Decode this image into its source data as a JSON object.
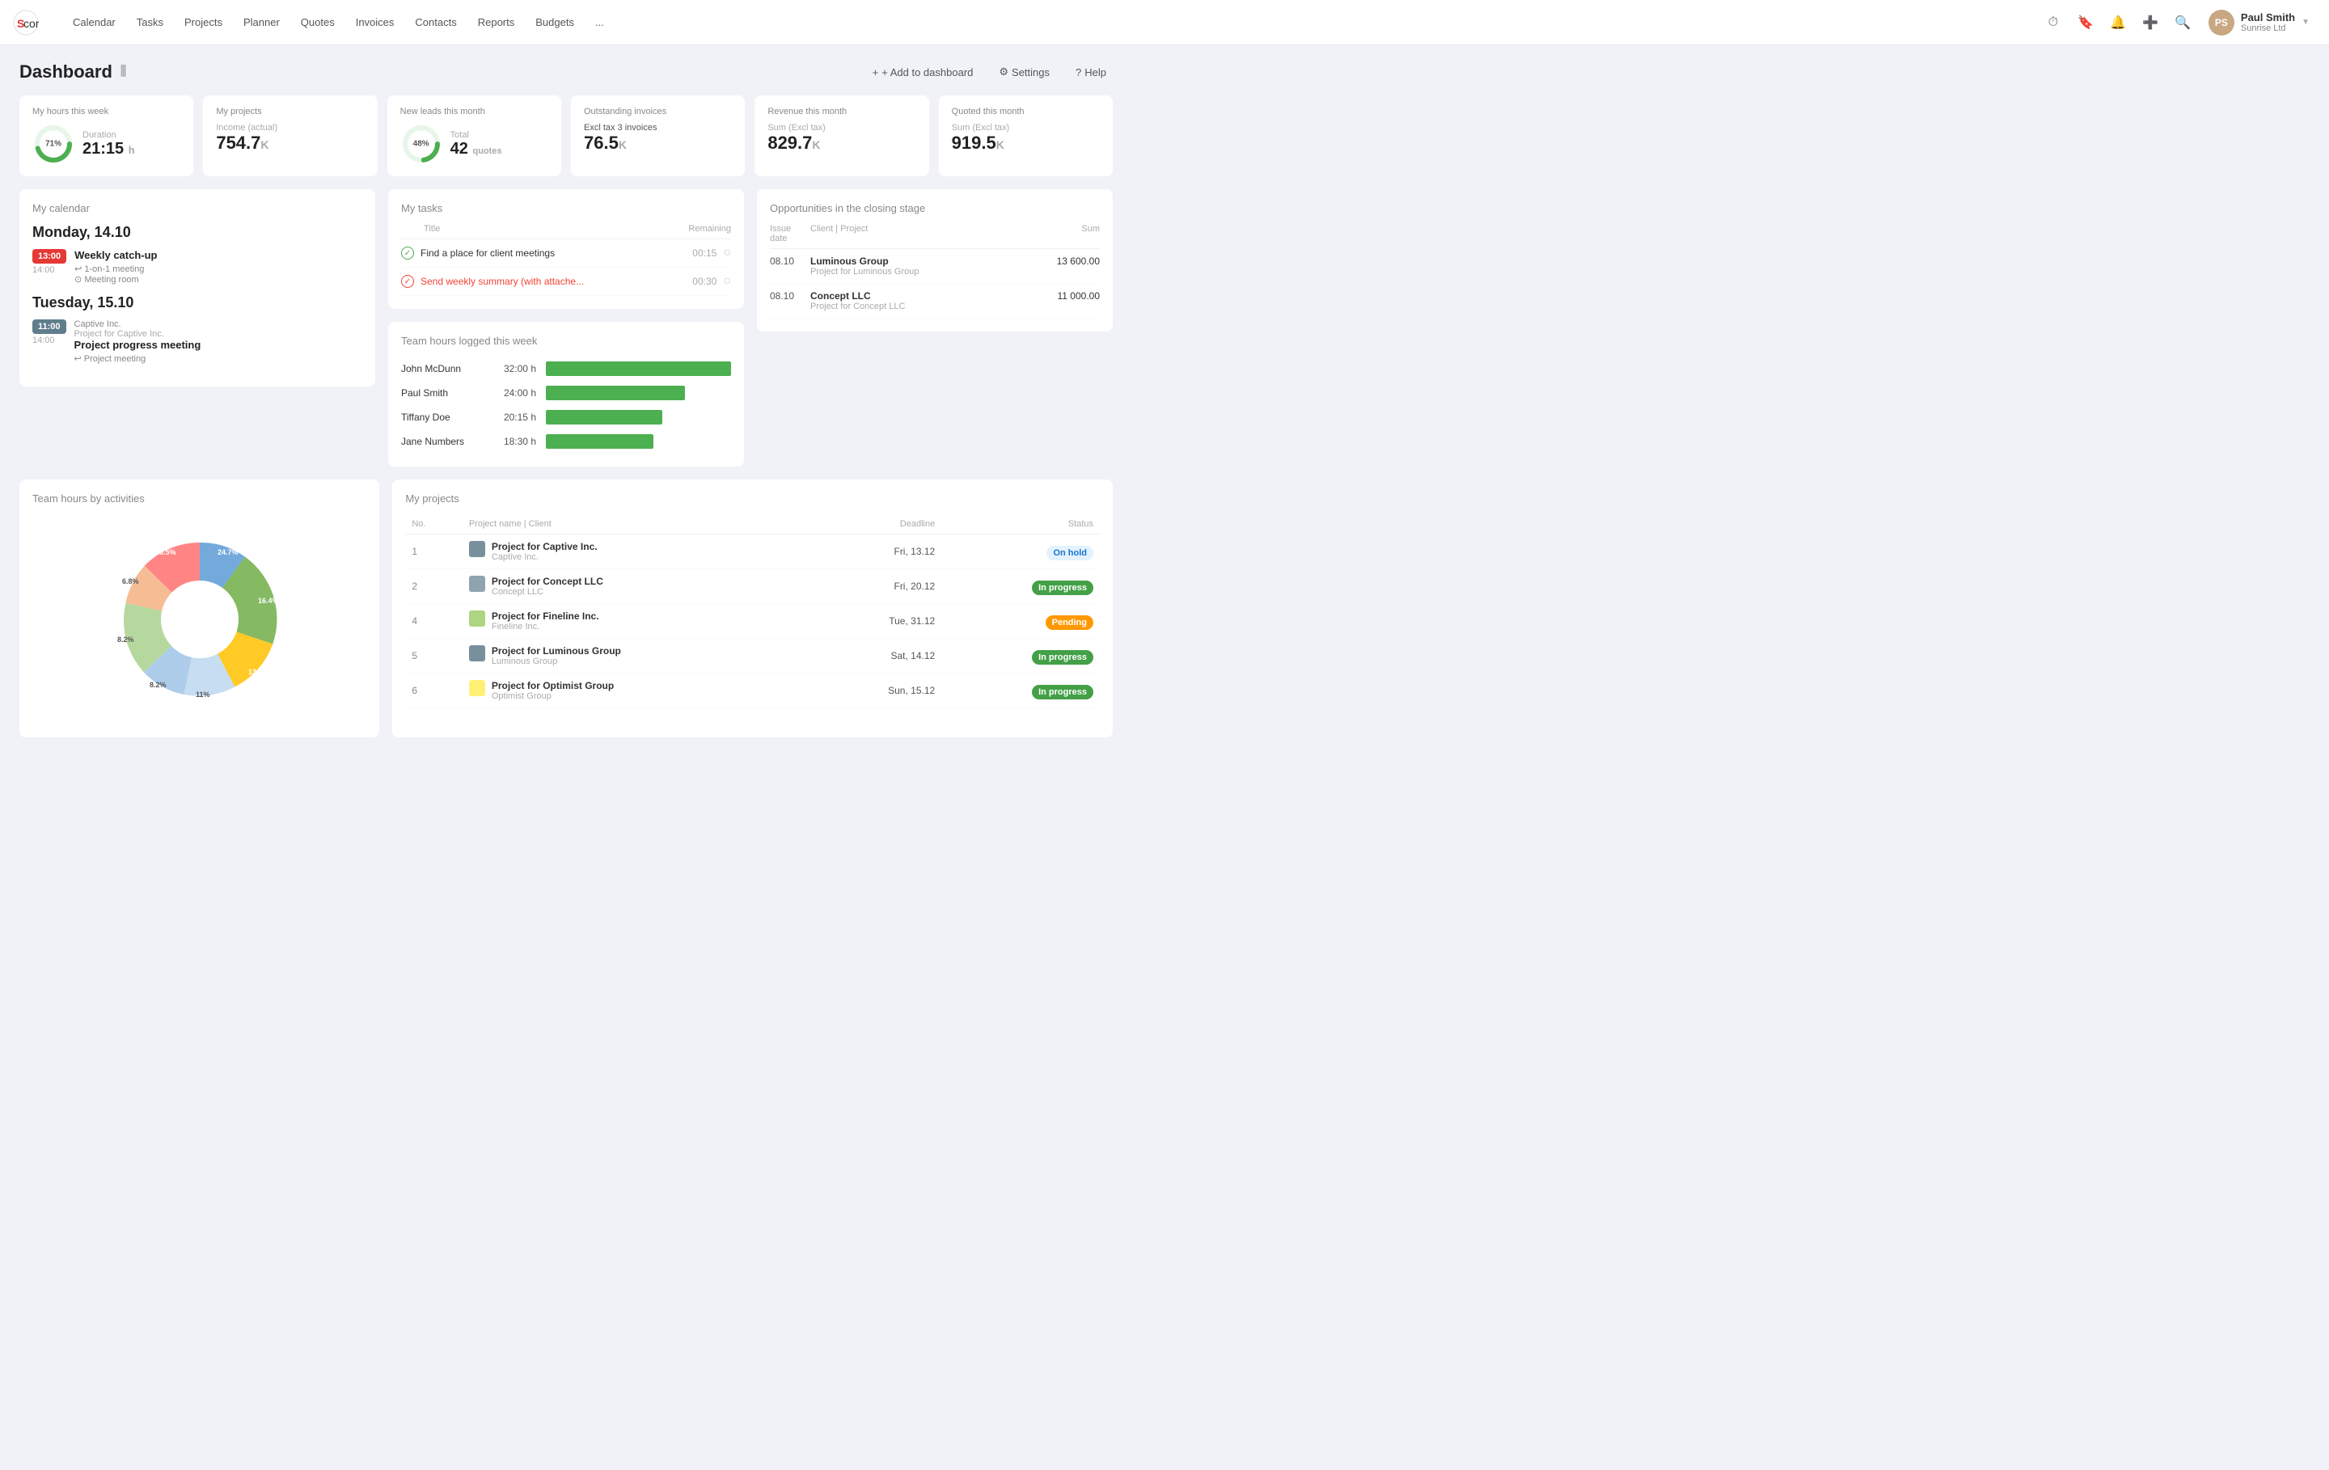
{
  "nav": {
    "logo_text": "Scoro",
    "links": [
      "Calendar",
      "Tasks",
      "Projects",
      "Planner",
      "Quotes",
      "Invoices",
      "Contacts",
      "Reports",
      "Budgets",
      "..."
    ],
    "user": {
      "name": "Paul Smith",
      "company": "Sunrise Ltd"
    }
  },
  "dashboard": {
    "title": "Dashboard",
    "actions": {
      "add": "+ Add to dashboard",
      "settings": "Settings",
      "help": "Help"
    }
  },
  "stat_cards": [
    {
      "label": "My hours this week",
      "has_donut": true,
      "donut_pct": 71,
      "donut_color": "#4caf50",
      "sub_label": "Duration",
      "value": "21:15",
      "unit": "h"
    },
    {
      "label": "My projects",
      "sub_label": "Income (actual)",
      "value": "754.7",
      "unit": "K"
    },
    {
      "label": "New leads this month",
      "has_donut": true,
      "donut_pct": 48,
      "donut_color": "#4caf50",
      "sub_label": "Total",
      "value": "42",
      "unit": "quotes"
    },
    {
      "label": "Outstanding invoices",
      "sub_label": "Excl tax 3 invoices",
      "value": "76.5",
      "unit": "K"
    },
    {
      "label": "Revenue this month",
      "sub_label": "Sum (Excl tax)",
      "value": "829.7",
      "unit": "K"
    },
    {
      "label": "Quoted this month",
      "sub_label": "Sum (Excl tax)",
      "value": "919.5",
      "unit": "K"
    }
  ],
  "calendar": {
    "title": "My calendar",
    "days": [
      {
        "date": "Monday, 14.10",
        "events": [
          {
            "start": "13:00",
            "end": "14:00",
            "title": "Weekly catch-up",
            "type": "1-on-1 meeting",
            "location": "Meeting room",
            "color": "#e53935"
          }
        ]
      },
      {
        "date": "Tuesday, 15.10",
        "events": [
          {
            "start": "11:00",
            "end": "14:00",
            "title": "Project progress meeting",
            "type": "Project meeting",
            "company": "Captive Inc.",
            "project": "Project for Captive Inc.",
            "color": "#607d8b"
          }
        ]
      }
    ]
  },
  "tasks": {
    "title": "My tasks",
    "columns": [
      "Title",
      "Remaining"
    ],
    "rows": [
      {
        "title": "Find a place for client meetings",
        "remaining": "00:15",
        "status": "done"
      },
      {
        "title": "Send weekly summary (with attache...",
        "remaining": "00:30",
        "status": "overdue"
      }
    ]
  },
  "team_hours": {
    "title": "Team hours logged this week",
    "rows": [
      {
        "name": "John McDunn",
        "hours": "32:00 h",
        "bar_pct": 100
      },
      {
        "name": "Paul Smith",
        "hours": "24:00 h",
        "bar_pct": 75
      },
      {
        "name": "Tiffany Doe",
        "hours": "20:15 h",
        "bar_pct": 63
      },
      {
        "name": "Jane Numbers",
        "hours": "18:30 h",
        "bar_pct": 58
      }
    ]
  },
  "opportunities": {
    "title": "Opportunities in the closing stage",
    "columns": [
      "Issue date",
      "Client | Project",
      "Sum"
    ],
    "rows": [
      {
        "date": "08.10",
        "client": "Luminous Group",
        "project": "Project for Luminous Group",
        "sum": "13 600.00"
      },
      {
        "date": "08.10",
        "client": "Concept LLC",
        "project": "Project for Concept LLC",
        "sum": "11 000.00"
      }
    ]
  },
  "team_hours_chart": {
    "title": "Team hours by activities",
    "segments": [
      {
        "pct": 24.7,
        "color": "#5b9bd5",
        "label": "24.7%"
      },
      {
        "pct": 16.4,
        "color": "#70ad47",
        "label": "16.4%"
      },
      {
        "pct": 13.7,
        "color": "#ffc000",
        "label": "13.7%"
      },
      {
        "pct": 11.0,
        "color": "#bdd7ee",
        "label": "11%"
      },
      {
        "pct": 8.2,
        "color": "#9dc3e6",
        "label": "8.2%"
      },
      {
        "pct": 8.2,
        "color": "#a9d18e",
        "label": "8.2%"
      },
      {
        "pct": 6.8,
        "color": "#f4b183",
        "label": "6.8%"
      },
      {
        "pct": 5.5,
        "color": "#ff7070",
        "label": "5.5%"
      }
    ]
  },
  "my_projects": {
    "title": "My projects",
    "columns": [
      "No.",
      "Project name | Client",
      "Deadline",
      "Status"
    ],
    "rows": [
      {
        "num": "1",
        "name": "Project for Captive Inc.",
        "client": "Captive Inc.",
        "deadline": "Fri, 13.12",
        "status": "On hold",
        "status_class": "onhold",
        "icon_color": "#78909c"
      },
      {
        "num": "2",
        "name": "Project for Concept LLC",
        "client": "Concept LLC",
        "deadline": "Fri, 20.12",
        "status": "In progress",
        "status_class": "inprogress",
        "icon_color": "#90a4ae"
      },
      {
        "num": "4",
        "name": "Project for Fineline Inc.",
        "client": "Fineline Inc.",
        "deadline": "Tue, 31.12",
        "status": "Pending",
        "status_class": "pending",
        "icon_color": "#aed581"
      },
      {
        "num": "5",
        "name": "Project for Luminous Group",
        "client": "Luminous Group",
        "deadline": "Sat, 14.12",
        "status": "In progress",
        "status_class": "inprogress",
        "icon_color": "#78909c"
      },
      {
        "num": "6",
        "name": "Project for Optimist Group",
        "client": "Optimist Group",
        "deadline": "Sun, 15.12",
        "status": "In progress",
        "status_class": "inprogress",
        "icon_color": "#fff176"
      }
    ]
  }
}
